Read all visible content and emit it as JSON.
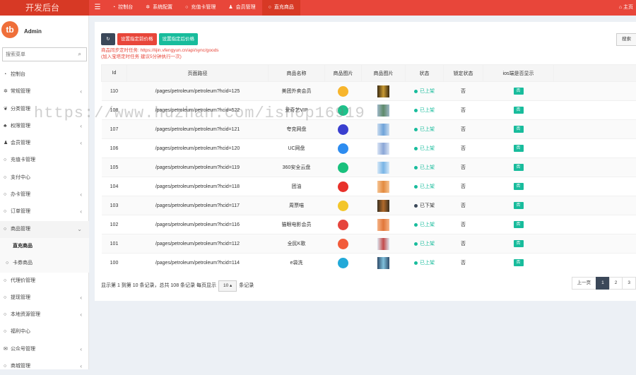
{
  "app": {
    "title": "开发后台",
    "home_label": "主页"
  },
  "nav": {
    "tabs": [
      {
        "icon": "dashboard-icon",
        "label": "控制台"
      },
      {
        "icon": "gear-icon",
        "label": "系统配置"
      },
      {
        "icon": "circle-icon",
        "label": "充值卡管理"
      },
      {
        "icon": "user-icon",
        "label": "会员管理"
      },
      {
        "icon": "circle-icon",
        "label": "直充商品"
      }
    ],
    "active_tab": 4
  },
  "user": {
    "name": "Admin",
    "avatar_text": "tb"
  },
  "sidebar": {
    "search_placeholder": "搜索菜单",
    "items": [
      {
        "label": "控制台",
        "icon": "dashboard-icon"
      },
      {
        "label": "常规管理",
        "icon": "gears-icon",
        "arrow": "‹"
      },
      {
        "label": "分类管理",
        "icon": "leaf-icon"
      },
      {
        "label": "权限管理",
        "icon": "group-icon",
        "arrow": "‹"
      },
      {
        "label": "会员管理",
        "icon": "user-icon",
        "arrow": "‹"
      },
      {
        "label": "充值卡管理",
        "icon": "circle-icon"
      },
      {
        "label": "支付中心",
        "icon": "circle-icon"
      },
      {
        "label": "办卡管理",
        "icon": "circle-icon",
        "arrow": "‹"
      },
      {
        "label": "订单管理",
        "icon": "circle-icon",
        "arrow": "‹"
      },
      {
        "label": "商品管理",
        "icon": "circle-icon",
        "arrow": "⌄"
      },
      {
        "label": "直充商品",
        "icon": "",
        "sub": true,
        "current": true
      },
      {
        "label": "卡券商品",
        "icon": "circle-icon",
        "sub": true
      },
      {
        "label": "代理价管理",
        "icon": "circle-icon"
      },
      {
        "label": "提现管理",
        "icon": "circle-icon",
        "arrow": "‹"
      },
      {
        "label": "本地资源管理",
        "icon": "circle-icon",
        "arrow": "‹"
      },
      {
        "label": "福利中心",
        "icon": "circle-icon"
      },
      {
        "label": "公众号管理",
        "icon": "wechat-icon",
        "arrow": "‹"
      },
      {
        "label": "商城管理",
        "icon": "circle-icon",
        "arrow": "‹"
      }
    ]
  },
  "toolbar": {
    "refresh_label": "↻",
    "btn1_label": "设置指定前价格",
    "btn2_label": "设置指定后价格",
    "search_label": "搜索"
  },
  "note": {
    "line1": "商品同步定时任务: https://lijin.vfengyun.cn/api/sync/goods",
    "line2": "(加入宝塔定时任务 建议5分钟执行一次)"
  },
  "table": {
    "headers": [
      "Id",
      "页面路径",
      "商品名称",
      "商品图片",
      "商品图片",
      "状态",
      "锁定状态",
      "ios端是否显示"
    ],
    "rows": [
      {
        "id": "110",
        "path": "/pages/petroleum/petroleum?hcid=125",
        "name": "美团外卖会员",
        "icon_color": "#f7b52c",
        "thumb": [
          "#3a2a10",
          "#c99a33"
        ],
        "status": "已上架",
        "on": true,
        "locked": "否",
        "ios": "否"
      },
      {
        "id": "108",
        "path": "/pages/petroleum/petroleum?hcid=522",
        "name": "爱奇艺VIP",
        "icon_color": "#1ec28b",
        "thumb": [
          "#9fb8c8",
          "#5e8a6a"
        ],
        "status": "已上架",
        "on": true,
        "locked": "否",
        "ios": "否"
      },
      {
        "id": "107",
        "path": "/pages/petroleum/petroleum?hcid=121",
        "name": "夸克网盘",
        "icon_color": "#3a3fcf",
        "thumb": [
          "#c9dcf0",
          "#6ea3d9"
        ],
        "status": "已上架",
        "on": true,
        "locked": "否",
        "ios": "否"
      },
      {
        "id": "106",
        "path": "/pages/petroleum/petroleum?hcid=120",
        "name": "UC网盘",
        "icon_color": "#2d8cf0",
        "thumb": [
          "#d9e4f5",
          "#8aa6d6"
        ],
        "status": "已上架",
        "on": true,
        "locked": "否",
        "ios": "否"
      },
      {
        "id": "105",
        "path": "/pages/petroleum/petroleum?hcid=119",
        "name": "360安全云盘",
        "icon_color": "#19c17d",
        "thumb": [
          "#d5e8f8",
          "#78b4e6"
        ],
        "status": "已上架",
        "on": true,
        "locked": "否",
        "ios": "否"
      },
      {
        "id": "104",
        "path": "/pages/petroleum/petroleum?hcid=118",
        "name": "团油",
        "icon_color": "#e8312b",
        "thumb": [
          "#f6c493",
          "#e38b3f"
        ],
        "status": "已上架",
        "on": true,
        "locked": "否",
        "ios": "否"
      },
      {
        "id": "103",
        "path": "/pages/petroleum/petroleum?hcid=117",
        "name": "周票喵",
        "icon_color": "#f3c62a",
        "thumb": [
          "#3b3020",
          "#b26a2a"
        ],
        "status": "已下架",
        "on": false,
        "locked": "否",
        "ios": "否"
      },
      {
        "id": "102",
        "path": "/pages/petroleum/petroleum?hcid=116",
        "name": "猫眼电影会员",
        "icon_color": "#e6453d",
        "thumb": [
          "#f5b487",
          "#e2773a"
        ],
        "status": "已上架",
        "on": true,
        "locked": "否",
        "ios": "否"
      },
      {
        "id": "101",
        "path": "/pages/petroleum/petroleum?hcid=112",
        "name": "全民K歌",
        "icon_color": "#f25b3a",
        "thumb": [
          "#dfe6ef",
          "#c24a4a"
        ],
        "status": "已上架",
        "on": true,
        "locked": "否",
        "ios": "否"
      },
      {
        "id": "100",
        "path": "/pages/petroleum/petroleum?hcid=114",
        "name": "e袋洗",
        "icon_color": "#22a9d8",
        "thumb": [
          "#2f4c6a",
          "#7fc0dc"
        ],
        "status": "已上架",
        "on": true,
        "locked": "否",
        "ios": "否"
      }
    ]
  },
  "pagination": {
    "info_before": "显示第 1 到第 10 条记录，总共 108 条记录 每页显示",
    "per_page": "10 ▴",
    "info_after": "条记录",
    "prev_label": "上一页",
    "pages": [
      "1",
      "2",
      "3"
    ],
    "current": "1"
  },
  "watermark": "https://www.huzhan.com/ishop16919",
  "colors": {
    "accent": "#e8463a",
    "success": "#18bc9c",
    "dark": "#3b4859"
  }
}
